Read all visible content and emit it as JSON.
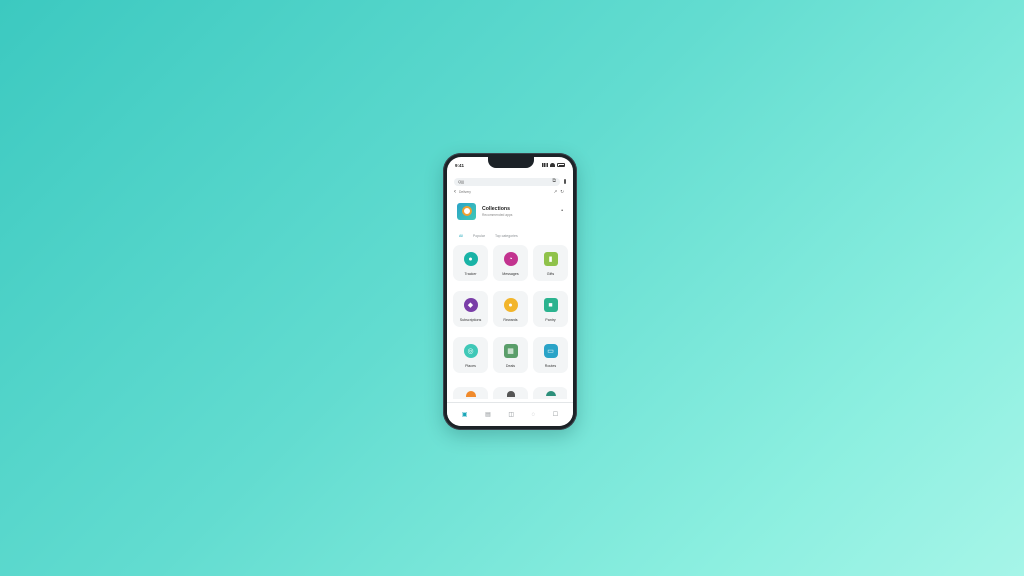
{
  "status": {
    "time": "9:41"
  },
  "search": {
    "text": "Q|||"
  },
  "url": {
    "text": "Delivery"
  },
  "header": {
    "title": "Collections",
    "subtitle": "Recommended apps"
  },
  "tabs": [
    {
      "label": "All",
      "active": true
    },
    {
      "label": "Popular",
      "active": false
    },
    {
      "label": "Top categories",
      "active": false
    }
  ],
  "tiles": [
    {
      "label": "Tracker",
      "icon": "pin-icon",
      "color": "#19b3a6",
      "glyph": "●"
    },
    {
      "label": "Messages",
      "icon": "chat-icon",
      "color": "#c2338f",
      "glyph": "◔"
    },
    {
      "label": "Gifts",
      "icon": "gift-icon",
      "color": "#8fc24a",
      "glyph": "▮"
    },
    {
      "label": "Subscriptions",
      "icon": "bag-icon",
      "color": "#7a3ea8",
      "glyph": "◆"
    },
    {
      "label": "Rewards",
      "icon": "coin-icon",
      "color": "#f2b52b",
      "glyph": "●"
    },
    {
      "label": "Pantry",
      "icon": "box-icon",
      "color": "#2bb38f",
      "glyph": "■"
    },
    {
      "label": "Places",
      "icon": "location-icon",
      "color": "#3fc8b7",
      "glyph": "◎"
    },
    {
      "label": "Deals",
      "icon": "ticket-icon",
      "color": "#5a9e6a",
      "glyph": "▦"
    },
    {
      "label": "Routes",
      "icon": "truck-icon",
      "color": "#2aa3c7",
      "glyph": "▭"
    }
  ],
  "bottom_nav": [
    {
      "icon": "home-icon",
      "active": true
    },
    {
      "icon": "grid-icon",
      "active": false
    },
    {
      "icon": "bag-icon",
      "active": false
    },
    {
      "icon": "chat-icon",
      "active": false
    },
    {
      "icon": "profile-icon",
      "active": false
    }
  ]
}
